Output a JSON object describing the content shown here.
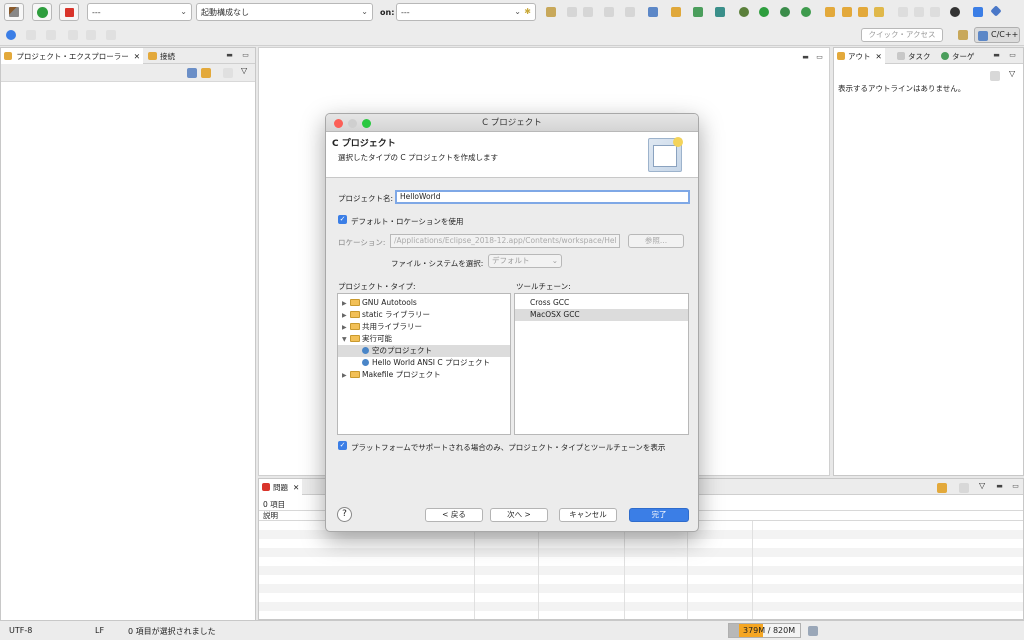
{
  "toolbar": {
    "combo_launch": "---",
    "combo_config": "起動構成なし",
    "on_label": "on:",
    "combo_target": "---",
    "quick_access_placeholder": "クイック・アクセス",
    "perspective_label": "C/C++"
  },
  "left_panel": {
    "tab_project_explorer": "プロジェクト・エクスプローラー",
    "tab_connections": "接続"
  },
  "right_panel": {
    "tab_outline": "アウト",
    "tab_tasks": "タスク",
    "tab_target": "ターゲ",
    "empty_message": "表示するアウトラインはありません。"
  },
  "bottom_panel": {
    "tab_problems": "問題",
    "item_count": "0 項目",
    "col_description": "説明"
  },
  "status_bar": {
    "encoding": "UTF-8",
    "line_ending": "LF",
    "selection": "0 項目が選択されました",
    "memory": "379M / 820M"
  },
  "dialog": {
    "window_title": "C プロジェクト",
    "header_title": "C プロジェクト",
    "header_subtitle": "選択したタイプの C プロジェクトを作成します",
    "project_name_label": "プロジェクト名:",
    "project_name_value": "HelloWorld",
    "use_default_location_label": "デフォルト・ロケーションを使用",
    "location_label": "ロケーション:",
    "location_value": "/Applications/Eclipse_2018-12.app/Contents/workspace/Hel",
    "browse_button": "参照...",
    "filesystem_label": "ファイル・システムを選択:",
    "filesystem_value": "デフォルト",
    "project_type_label": "プロジェクト・タイプ:",
    "toolchain_label": "ツールチェーン:",
    "project_types": [
      {
        "label": "GNU Autotools",
        "kind": "folder",
        "expanded": false,
        "indent": 0
      },
      {
        "label": "static ライブラリー",
        "kind": "folder",
        "expanded": false,
        "indent": 0
      },
      {
        "label": "共用ライブラリー",
        "kind": "folder",
        "expanded": false,
        "indent": 0
      },
      {
        "label": "実行可能",
        "kind": "folder",
        "expanded": true,
        "indent": 0
      },
      {
        "label": "空のプロジェクト",
        "kind": "item",
        "selected": true,
        "indent": 1
      },
      {
        "label": "Hello World ANSI C プロジェクト",
        "kind": "item",
        "indent": 1
      },
      {
        "label": "Makefile プロジェクト",
        "kind": "folder",
        "expanded": false,
        "indent": 0
      }
    ],
    "toolchains": [
      {
        "label": "Cross GCC",
        "selected": false
      },
      {
        "label": "MacOSX GCC",
        "selected": true
      }
    ],
    "platform_filter_label": "プラットフォームでサポートされる場合のみ、プロジェクト・タイプとツールチェーンを表示",
    "help_label": "?",
    "back_button": "< 戻る",
    "next_button": "次へ >",
    "cancel_button": "キャンセル",
    "finish_button": "完了"
  },
  "colors": {
    "accent": "#3b7ee6",
    "selection_gray": "#dcdcdc",
    "memory_bar": "#f5a623"
  }
}
